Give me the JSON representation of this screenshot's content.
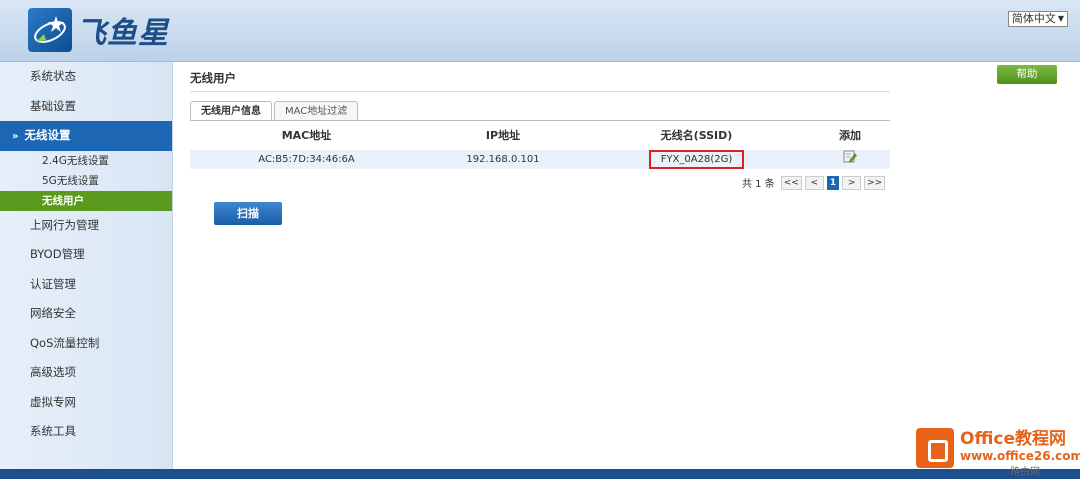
{
  "header": {
    "brand": "飞鱼星",
    "language": "简体中文"
  },
  "sidebar": {
    "items": [
      {
        "label": "系统状态"
      },
      {
        "label": "基础设置"
      },
      {
        "label": "无线设置"
      },
      {
        "label": "上网行为管理"
      },
      {
        "label": "BYOD管理"
      },
      {
        "label": "认证管理"
      },
      {
        "label": "网络安全"
      },
      {
        "label": "QoS流量控制"
      },
      {
        "label": "高级选项"
      },
      {
        "label": "虚拟专网"
      },
      {
        "label": "系统工具"
      }
    ],
    "sub_items": [
      {
        "label": "2.4G无线设置"
      },
      {
        "label": "5G无线设置"
      },
      {
        "label": "无线用户"
      }
    ]
  },
  "main": {
    "title": "无线用户",
    "help_label": "帮助",
    "tabs": [
      {
        "label": "无线用户信息"
      },
      {
        "label": "MAC地址过滤"
      }
    ],
    "table": {
      "headers": [
        "MAC地址",
        "IP地址",
        "无线名(SSID)",
        "添加"
      ],
      "rows": [
        {
          "mac": "AC:B5:7D:34:46:6A",
          "ip": "192.168.0.101",
          "ssid": "FYX_0A28(2G)"
        }
      ]
    },
    "pager": {
      "total": "共 1 条",
      "first": "<<",
      "prev": "<",
      "current": "1",
      "next": ">",
      "last": ">>"
    },
    "scan_label": "扫描"
  },
  "watermark": {
    "title": "Office教程网",
    "url": "www.office26.com",
    "sub": "路由网"
  },
  "colors": {
    "accent_blue": "#1d66b3",
    "selected_green": "#5a9a1e",
    "highlight_red": "#e21e1e"
  }
}
